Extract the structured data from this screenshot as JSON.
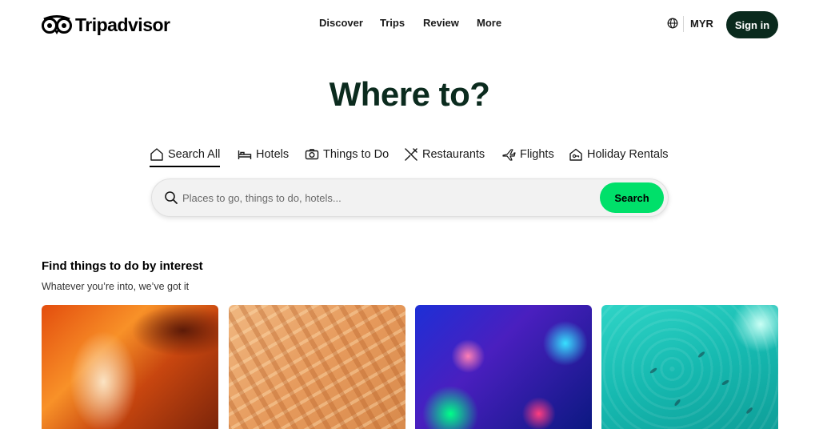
{
  "header": {
    "logo_text": "Tripadvisor",
    "nav": [
      "Discover",
      "Trips",
      "Review",
      "More"
    ],
    "currency": "MYR",
    "sign_in": "Sign in"
  },
  "hero": {
    "title": "Where to?"
  },
  "tabs": [
    {
      "label": "Search All",
      "icon": "house-icon",
      "active": true
    },
    {
      "label": "Hotels",
      "icon": "bed-icon",
      "active": false
    },
    {
      "label": "Things to Do",
      "icon": "camera-icon",
      "active": false
    },
    {
      "label": "Restaurants",
      "icon": "utensils-icon",
      "active": false
    },
    {
      "label": "Flights",
      "icon": "plane-icon",
      "active": false
    },
    {
      "label": "Holiday Rentals",
      "icon": "rental-home-icon",
      "active": false
    }
  ],
  "search": {
    "placeholder": "Places to go, things to do, hotels...",
    "button": "Search"
  },
  "section": {
    "title": "Find things to do by interest",
    "subtitle": "Whatever you’re into, we’ve got it"
  },
  "colors": {
    "brand_dark": "#0b2b1e",
    "search_button": "#00e06a",
    "sign_in_bg": "#0a2a1d"
  }
}
